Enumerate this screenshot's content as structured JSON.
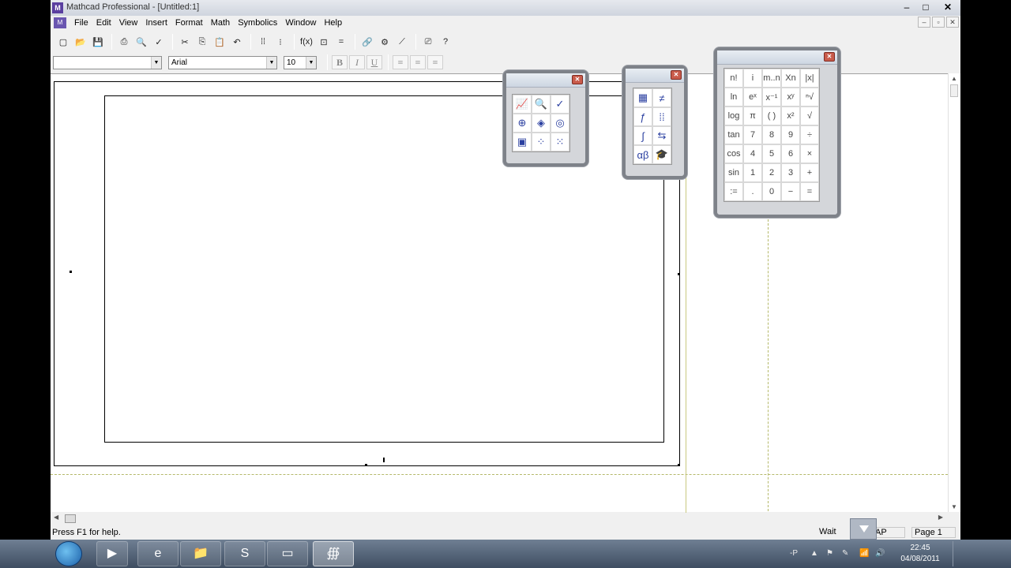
{
  "window": {
    "title": "Mathcad Professional - [Untitled:1]",
    "controls": [
      "–",
      "□",
      "✕"
    ]
  },
  "menu": {
    "items": [
      "File",
      "Edit",
      "View",
      "Insert",
      "Format",
      "Math",
      "Symbolics",
      "Window",
      "Help"
    ],
    "mdi_controls": [
      "–",
      "▫",
      "✕"
    ]
  },
  "toolbar": {
    "buttons": [
      "new-icon",
      "open-icon",
      "save-icon",
      "print-icon",
      "print-preview-icon",
      "spell-check-icon",
      "cut-icon",
      "copy-icon",
      "paste-icon",
      "undo-icon",
      "align-across-icon",
      "align-down-icon",
      "insert-function-icon",
      "insert-unit-icon",
      "calculate-icon",
      "insert-hyperlink-icon",
      "component-wizard-icon",
      "run-mathconnex-icon",
      "resource-center-icon",
      "help-icon"
    ],
    "glyphs": [
      "▢",
      "📂",
      "💾",
      "⎙",
      "🔍",
      "✓",
      "✂",
      "⎘",
      "📋",
      "↶",
      "⁞⁞",
      "⁝",
      "f(x)",
      "⊡",
      "=",
      "🔗",
      "⚙",
      "⟋",
      "⎚",
      "?"
    ]
  },
  "format_bar": {
    "style_value": "",
    "font_value": "Arial",
    "size_value": "10",
    "bold": "B",
    "italic": "I",
    "underline": "U",
    "align": [
      "≡",
      "≡",
      "≡"
    ]
  },
  "status": {
    "help_text": "Press F1 for help.",
    "wait": "Wait",
    "cap": "AP",
    "page": "Page 1"
  },
  "palettes": {
    "calculator": {
      "keys": [
        "n!",
        "i",
        "m..n",
        "Xn",
        "|x|",
        "ln",
        "eˣ",
        "x⁻¹",
        "xʸ",
        "ⁿ√",
        "log",
        "π",
        "( )",
        "x²",
        "√",
        "tan",
        "7",
        "8",
        "9",
        "÷",
        "cos",
        "4",
        "5",
        "6",
        "×",
        "sin",
        "1",
        "2",
        "3",
        "+",
        ":=",
        ".",
        "0",
        "−",
        "="
      ]
    },
    "graph": {
      "icons": [
        "x-y-plot-icon",
        "zoom-icon",
        "trace-icon",
        "polar-plot-icon",
        "surface-plot-icon",
        "contour-plot-icon",
        "3d-bar-plot-icon",
        "scatter-plot-icon",
        "vector-field-plot-icon"
      ],
      "glyphs": [
        "📈",
        "🔍",
        "✓",
        "⊕",
        "◈",
        "◎",
        "▣",
        "⁘",
        "⁙"
      ]
    },
    "math_toolbar": {
      "icons": [
        "calculator-palette-icon",
        "evaluation-palette-icon",
        "graph-palette-icon",
        "matrix-palette-icon",
        "calculus-palette-icon",
        "boolean-palette-icon",
        "greek-palette-icon",
        "symbolic-palette-icon"
      ],
      "glyphs": [
        "▦",
        "≠",
        "ƒ",
        "⁞⁞",
        "∫",
        "⇆",
        "αβ",
        "🎓"
      ]
    }
  },
  "taskbar": {
    "apps": [
      "ie-icon",
      "explorer-icon",
      "skype-icon",
      "window-icon",
      "mathcad-icon"
    ],
    "app_glyphs": [
      "e",
      "📁",
      "S",
      "▭",
      "∰"
    ],
    "media_glyph": "▶",
    "tray_symbols": [
      "▲",
      "⚑",
      "✎",
      "📶",
      "🔊"
    ],
    "lang": "-P",
    "time": "22:45",
    "date": "04/08/2011"
  }
}
